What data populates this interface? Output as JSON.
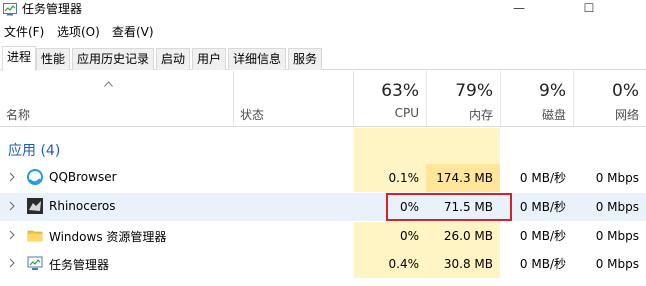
{
  "window": {
    "title": "任务管理器",
    "minimize": "—",
    "maximize": "☐"
  },
  "menu": [
    "文件(F)",
    "选项(O)",
    "查看(V)"
  ],
  "tabs": [
    "进程",
    "性能",
    "应用历史记录",
    "启动",
    "用户",
    "详细信息",
    "服务"
  ],
  "columns": {
    "name": "名称",
    "status": "状态",
    "cpu": {
      "pct": "63%",
      "label": "CPU"
    },
    "memory": {
      "pct": "79%",
      "label": "内存"
    },
    "disk": {
      "pct": "9%",
      "label": "磁盘"
    },
    "network": {
      "pct": "0%",
      "label": "网络"
    }
  },
  "group": {
    "label": "应用 (4)"
  },
  "rows": [
    {
      "name": "QQBrowser",
      "cpu": "0.1%",
      "memory": "174.3 MB",
      "disk": "0 MB/秒",
      "network": "0 Mbps",
      "icon": "qqbrowser-icon"
    },
    {
      "name": "Rhinoceros",
      "cpu": "0%",
      "memory": "71.5 MB",
      "disk": "0 MB/秒",
      "network": "0 Mbps",
      "icon": "rhino-icon"
    },
    {
      "name": "Windows 资源管理器",
      "cpu": "0%",
      "memory": "26.0 MB",
      "disk": "0 MB/秒",
      "network": "0 Mbps",
      "icon": "folder-icon"
    },
    {
      "name": "任务管理器",
      "cpu": "0.4%",
      "memory": "30.8 MB",
      "disk": "0 MB/秒",
      "network": "0 Mbps",
      "icon": "task-manager-icon"
    }
  ],
  "colors": {
    "accent": "#1f5fb8",
    "heat_low": "#fff4c4",
    "heat_mid": "#ffe69a",
    "selection": "#e9f2fb",
    "annotation": "#d0232b"
  }
}
